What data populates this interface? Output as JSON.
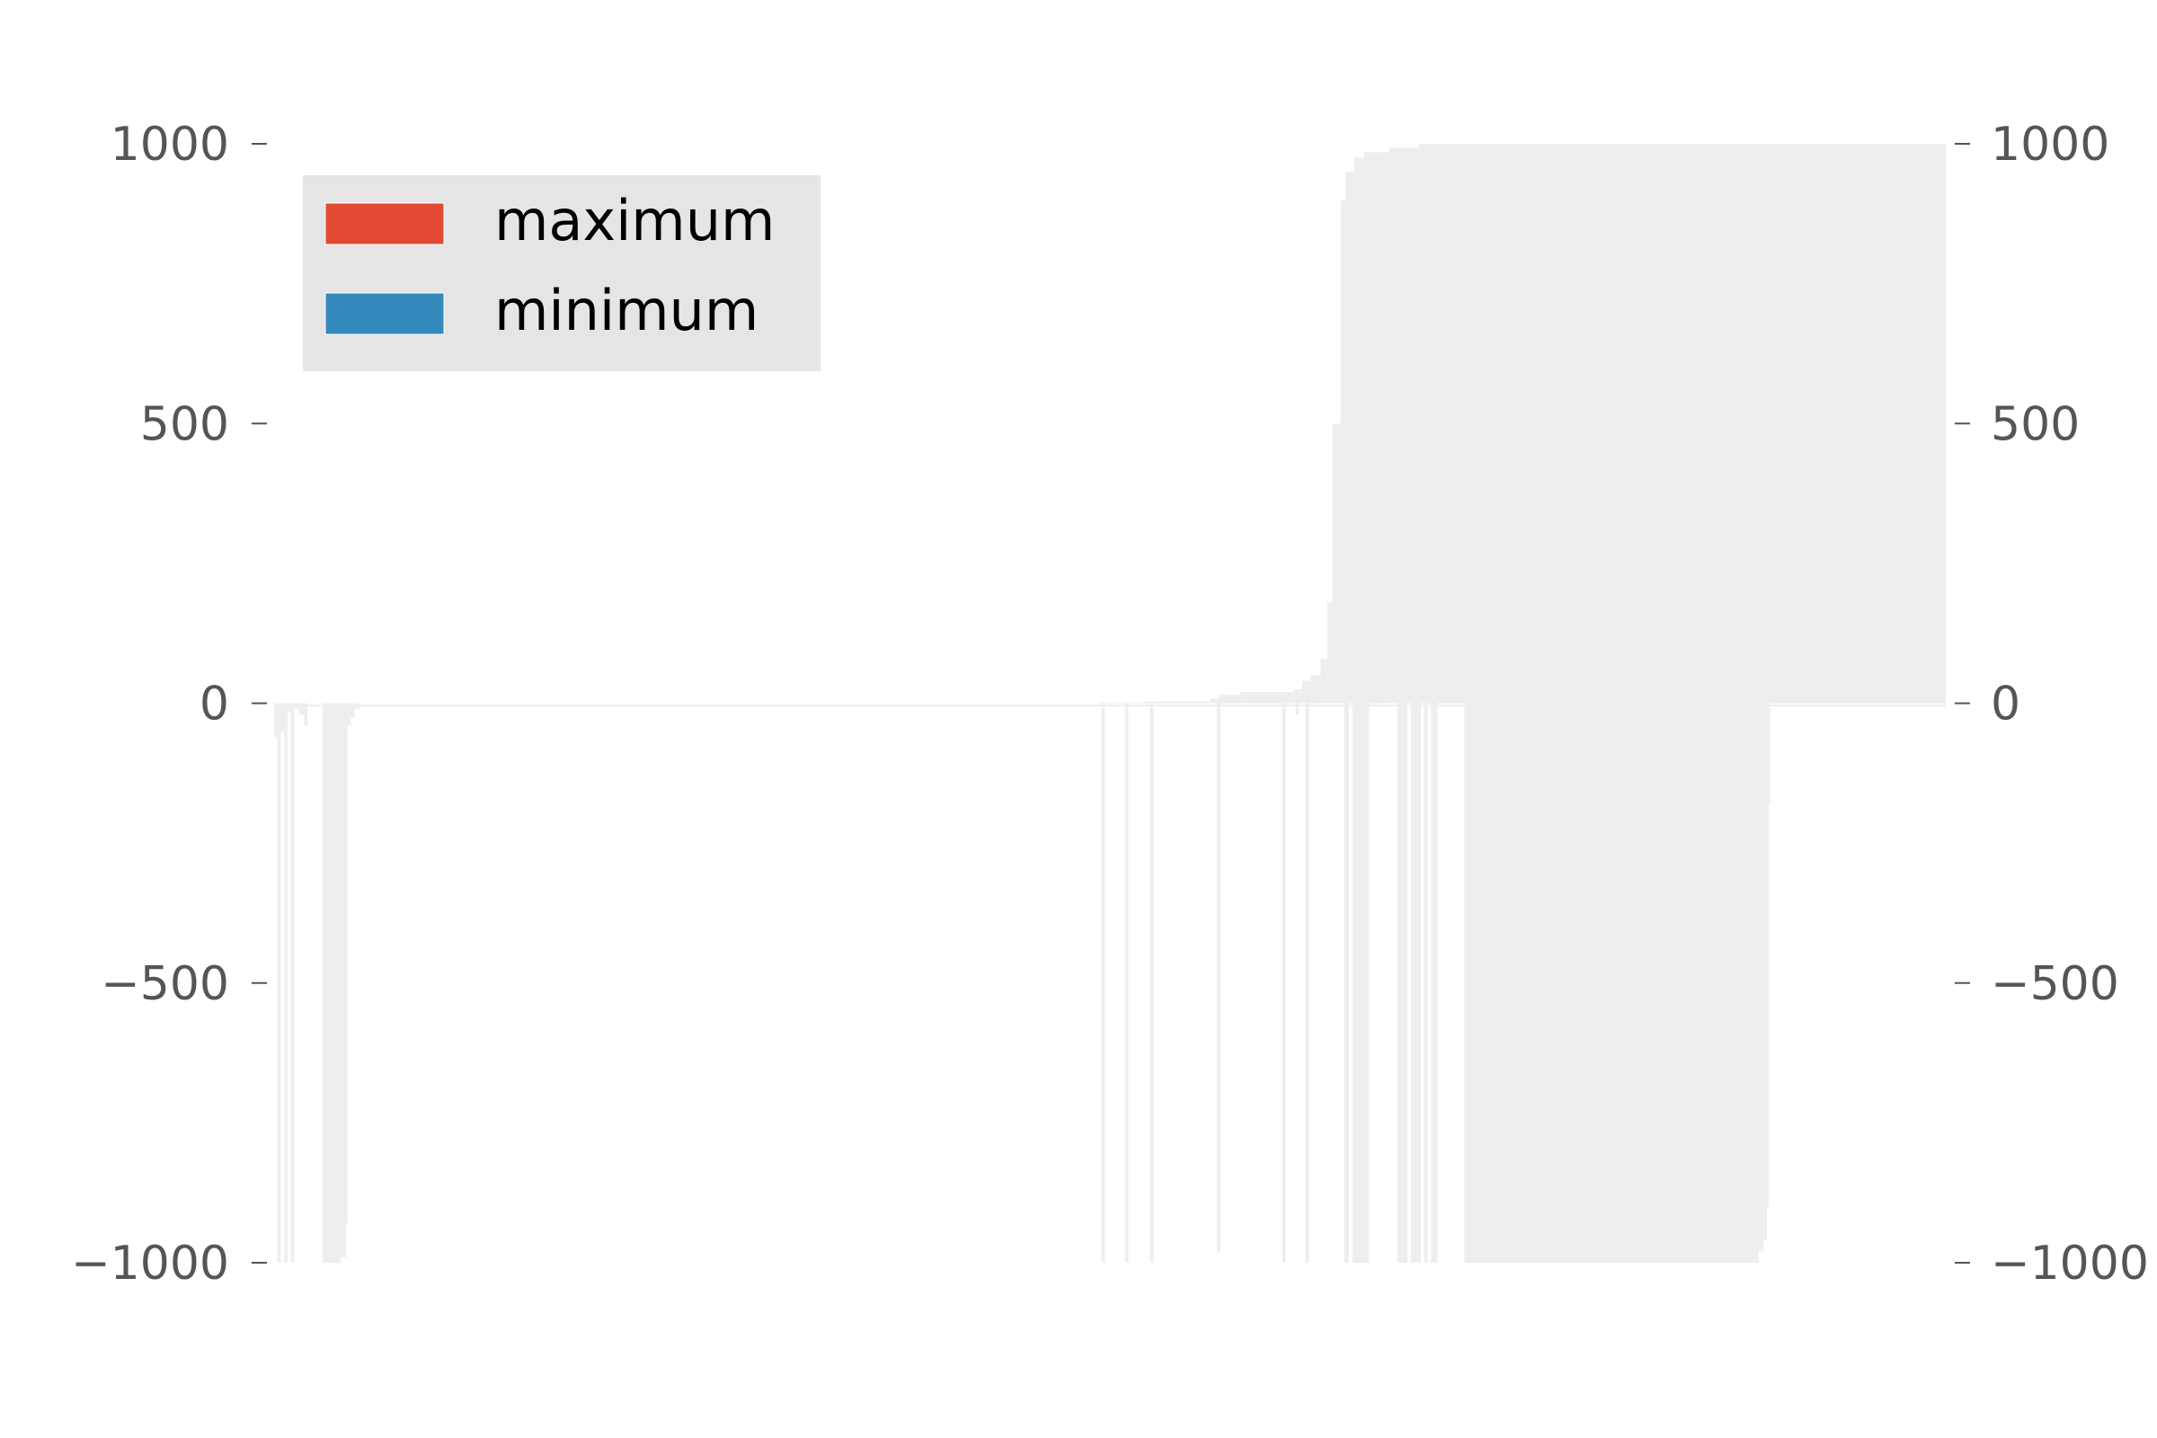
{
  "chart_data": {
    "type": "bar",
    "title": "",
    "xlabel": "",
    "ylabel": "",
    "ylim": [
      -1000,
      1000
    ],
    "yticks": [
      1000,
      500,
      0,
      -500,
      -1000
    ],
    "ytick_labels": [
      "1000",
      "500",
      "0",
      "−500",
      "−1000"
    ],
    "xlim": [
      0,
      1000
    ],
    "secondary_y_axis": true,
    "grid": false,
    "legend_position": "upper-left",
    "colors": {
      "bars": "#eeeeee",
      "maximum": "#E24A33",
      "minimum": "#348ABD",
      "legend_bg": "#e5e5e5",
      "tick_text": "#555555",
      "legend_text": "#000000"
    },
    "series": [
      {
        "name": "maximum",
        "values_by_range": [
          {
            "from": 0,
            "to": 495,
            "value": 0
          },
          {
            "from": 495,
            "to": 520,
            "value": 1
          },
          {
            "from": 520,
            "to": 560,
            "value": 3
          },
          {
            "from": 560,
            "to": 565,
            "value": 8
          },
          {
            "from": 565,
            "to": 578,
            "value": 15
          },
          {
            "from": 578,
            "to": 610,
            "value": 20
          },
          {
            "from": 610,
            "to": 615,
            "value": 25
          },
          {
            "from": 615,
            "to": 620,
            "value": 40
          },
          {
            "from": 620,
            "to": 626,
            "value": 50
          },
          {
            "from": 626,
            "to": 630,
            "value": 80
          },
          {
            "from": 630,
            "to": 633,
            "value": 180
          },
          {
            "from": 633,
            "to": 638,
            "value": 500
          },
          {
            "from": 638,
            "to": 641,
            "value": 900
          },
          {
            "from": 641,
            "to": 646,
            "value": 950
          },
          {
            "from": 646,
            "to": 652,
            "value": 975
          },
          {
            "from": 652,
            "to": 667,
            "value": 985
          },
          {
            "from": 667,
            "to": 685,
            "value": 993
          },
          {
            "from": 685,
            "to": 1000,
            "value": 1000
          }
        ]
      },
      {
        "name": "minimum",
        "values_by_range": [
          {
            "from": 0,
            "to": 2,
            "value": -60
          },
          {
            "from": 2,
            "to": 4,
            "value": -1000
          },
          {
            "from": 4,
            "to": 6,
            "value": -50
          },
          {
            "from": 6,
            "to": 8,
            "value": -1000
          },
          {
            "from": 8,
            "to": 10,
            "value": -15
          },
          {
            "from": 10,
            "to": 12,
            "value": -1000
          },
          {
            "from": 12,
            "to": 15,
            "value": -10
          },
          {
            "from": 15,
            "to": 18,
            "value": -20
          },
          {
            "from": 18,
            "to": 20,
            "value": -40
          },
          {
            "from": 20,
            "to": 29,
            "value": 0
          },
          {
            "from": 29,
            "to": 40,
            "value": -1000
          },
          {
            "from": 40,
            "to": 43,
            "value": -990
          },
          {
            "from": 43,
            "to": 44,
            "value": -930
          },
          {
            "from": 44,
            "to": 46,
            "value": -40
          },
          {
            "from": 46,
            "to": 48,
            "value": -25
          },
          {
            "from": 48,
            "to": 51,
            "value": -10
          },
          {
            "from": 51,
            "to": 495,
            "value": 0
          },
          {
            "from": 495,
            "to": 497,
            "value": -1000
          },
          {
            "from": 497,
            "to": 509,
            "value": 0
          },
          {
            "from": 509,
            "to": 511,
            "value": -1000
          },
          {
            "from": 511,
            "to": 524,
            "value": 0
          },
          {
            "from": 524,
            "to": 526,
            "value": -1000
          },
          {
            "from": 526,
            "to": 564,
            "value": 0
          },
          {
            "from": 564,
            "to": 566,
            "value": -980
          },
          {
            "from": 566,
            "to": 603,
            "value": 0
          },
          {
            "from": 603,
            "to": 605,
            "value": -1000
          },
          {
            "from": 605,
            "to": 611,
            "value": 0
          },
          {
            "from": 611,
            "to": 613,
            "value": -20
          },
          {
            "from": 613,
            "to": 617,
            "value": 0
          },
          {
            "from": 617,
            "to": 619,
            "value": -1000
          },
          {
            "from": 619,
            "to": 640,
            "value": 0
          },
          {
            "from": 640,
            "to": 643,
            "value": -1000
          },
          {
            "from": 643,
            "to": 645,
            "value": 0
          },
          {
            "from": 645,
            "to": 655,
            "value": -1000
          },
          {
            "from": 655,
            "to": 672,
            "value": 0
          },
          {
            "from": 672,
            "to": 678,
            "value": -1000
          },
          {
            "from": 678,
            "to": 680,
            "value": 0
          },
          {
            "from": 680,
            "to": 686,
            "value": -1000
          },
          {
            "from": 686,
            "to": 688,
            "value": 0
          },
          {
            "from": 688,
            "to": 690,
            "value": -1000
          },
          {
            "from": 690,
            "to": 692,
            "value": 0
          },
          {
            "from": 692,
            "to": 696,
            "value": -1000
          },
          {
            "from": 696,
            "to": 712,
            "value": 0
          },
          {
            "from": 712,
            "to": 888,
            "value": -1000
          },
          {
            "from": 888,
            "to": 891,
            "value": -980
          },
          {
            "from": 891,
            "to": 893,
            "value": -960
          },
          {
            "from": 893,
            "to": 894,
            "value": -900
          },
          {
            "from": 894,
            "to": 895,
            "value": -180
          },
          {
            "from": 895,
            "to": 1000,
            "value": 0
          }
        ]
      }
    ]
  }
}
